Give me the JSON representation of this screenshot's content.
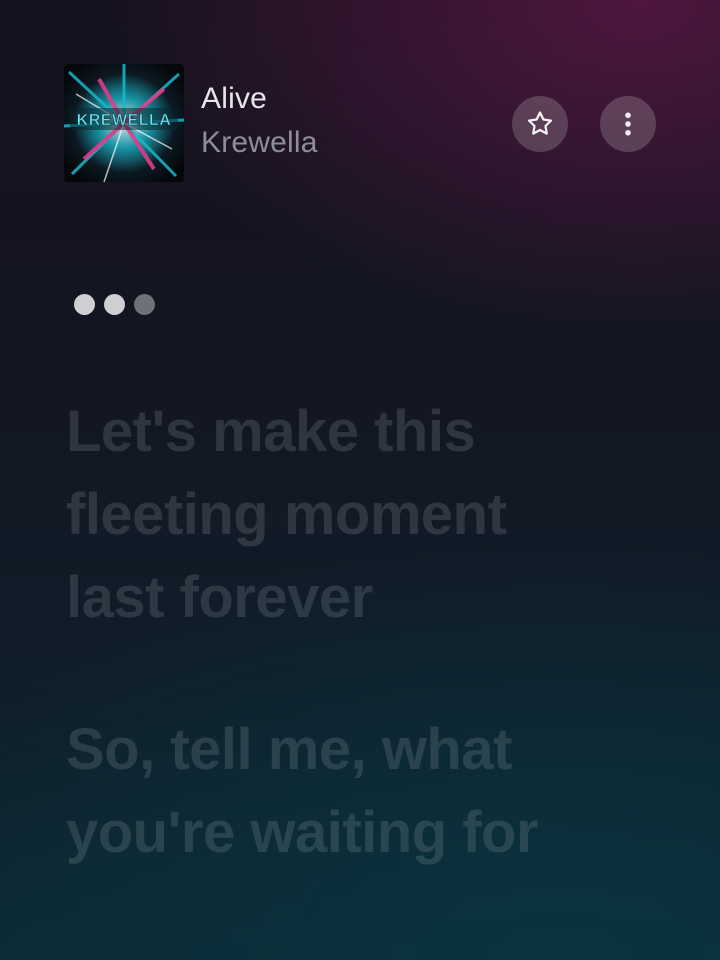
{
  "now_playing": {
    "title": "Alive",
    "artist": "Krewella",
    "album_art": {
      "icon": "album-art",
      "logo_text": "KREWELLA",
      "colors": [
        "#1bb7c9",
        "#e03b8b",
        "#ffffff"
      ]
    }
  },
  "actions": {
    "favorite": {
      "icon": "star-icon"
    },
    "more": {
      "icon": "more-vertical-icon"
    }
  },
  "progress_dots": {
    "count": 3,
    "active_index": [
      0,
      1
    ]
  },
  "lyrics": {
    "lines": [
      "Let's make this",
      "fleeting moment",
      "last forever",
      "",
      "So, tell me, what",
      "you're waiting for"
    ]
  },
  "colors": {
    "lyric_text": "rgba(150,160,170,0.22)",
    "title_text": "#e6e6ea",
    "artist_text": "#8e8e98",
    "accent_magenta": "#621848",
    "accent_teal": "#0c2a34"
  }
}
